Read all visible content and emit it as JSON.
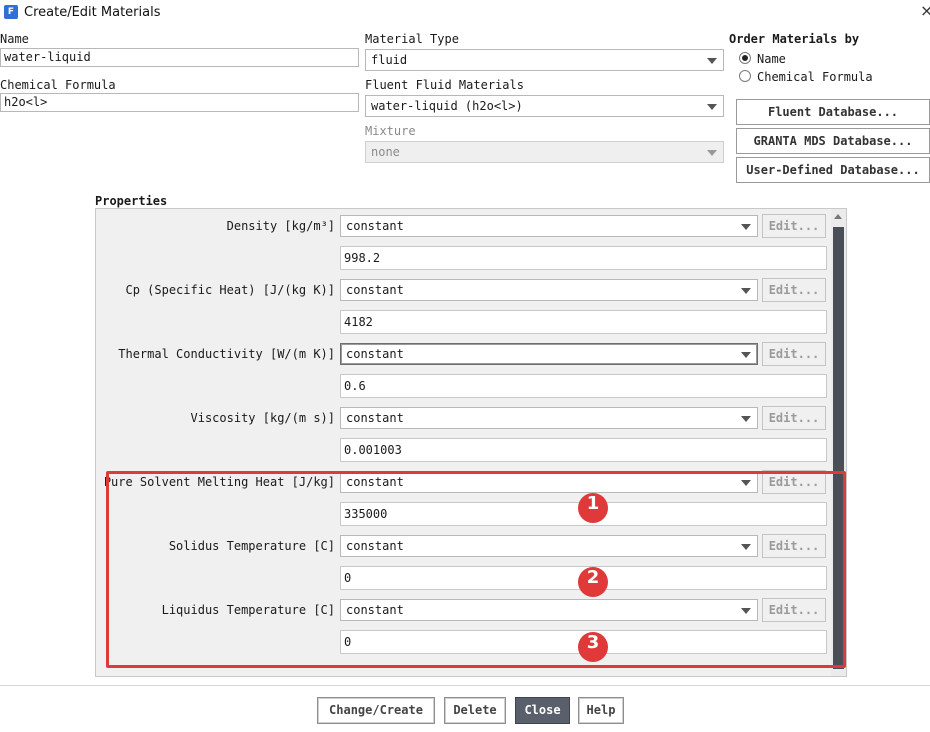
{
  "window": {
    "title": "Create/Edit Materials",
    "icon_letter": "F"
  },
  "left": {
    "name_label": "Name",
    "name_value": "water-liquid",
    "formula_label": "Chemical Formula",
    "formula_value": "h2o<l>"
  },
  "middle": {
    "material_type_label": "Material Type",
    "material_type_value": "fluid",
    "fluent_fluid_label": "Fluent Fluid Materials",
    "fluent_fluid_value": "water-liquid (h2o<l>)",
    "mixture_label": "Mixture",
    "mixture_value": "none"
  },
  "order": {
    "title": "Order Materials by",
    "options": [
      "Name",
      "Chemical Formula"
    ],
    "selected": "Name"
  },
  "databases": [
    "Fluent Database...",
    "GRANTA MDS Database...",
    "User-Defined Database..."
  ],
  "properties": {
    "title": "Properties",
    "edit_label": "Edit...",
    "items": [
      {
        "label": "Density [kg/m³]",
        "method": "constant",
        "value": "998.2"
      },
      {
        "label": "Cp (Specific Heat) [J/(kg K)]",
        "method": "constant",
        "value": "4182"
      },
      {
        "label": "Thermal Conductivity [W/(m K)]",
        "method": "constant",
        "value": "0.6"
      },
      {
        "label": "Viscosity [kg/(m s)]",
        "method": "constant",
        "value": "0.001003"
      },
      {
        "label": "Pure Solvent Melting Heat [J/kg]",
        "method": "constant",
        "value": "335000"
      },
      {
        "label": "Solidus Temperature [C]",
        "method": "constant",
        "value": "0"
      },
      {
        "label": "Liquidus Temperature [C]",
        "method": "constant",
        "value": "0"
      }
    ]
  },
  "annotations": {
    "badges": [
      "1",
      "2",
      "3"
    ],
    "color": "#e0393a"
  },
  "buttons": {
    "change_create": "Change/Create",
    "delete": "Delete",
    "close": "Close",
    "help": "Help"
  }
}
